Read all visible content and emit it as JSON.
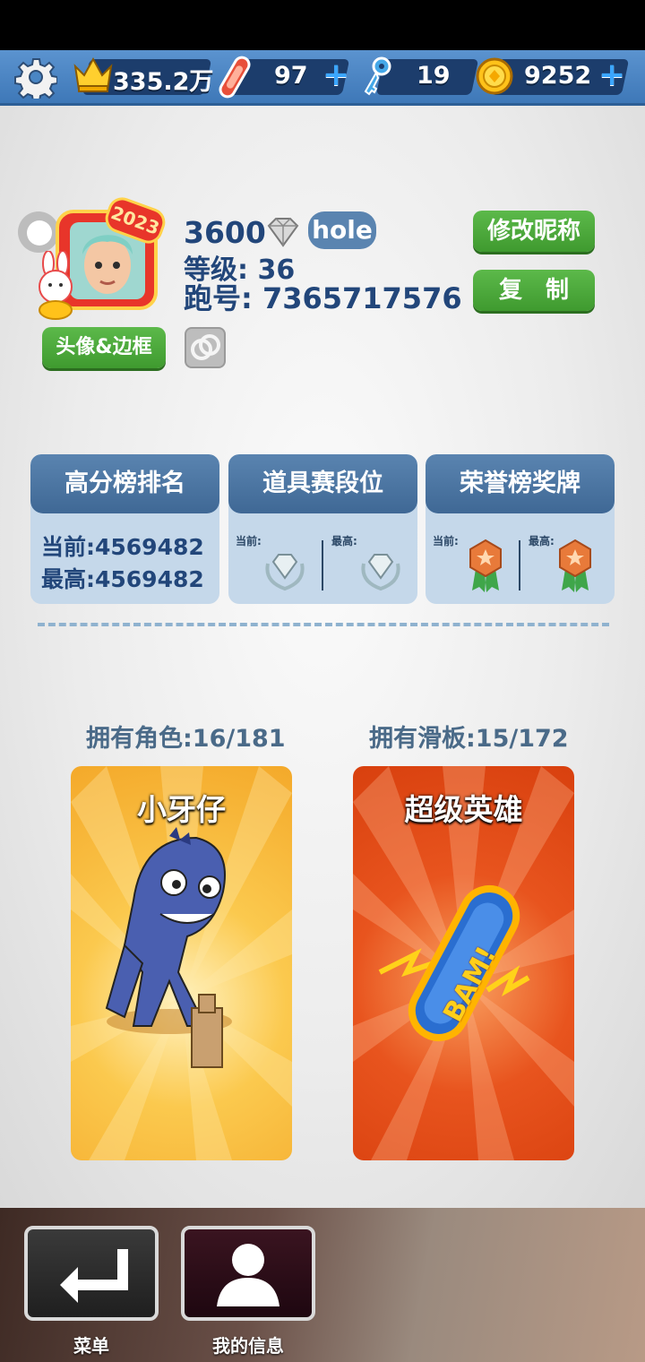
{
  "topbar": {
    "trophies": "335.2万",
    "boards": "97",
    "keys": "19",
    "coins": "9252",
    "plus": "+"
  },
  "profile": {
    "year_badge": "2023",
    "score": "3600",
    "crew": "hole",
    "level": "等级: 36",
    "runner_id": "跑号: 7365717576",
    "rename_label": "修改昵称",
    "copy_label": "复　制",
    "avatar_frame_label": "头像&边框"
  },
  "stats": {
    "highscore": {
      "title": "高分榜排名",
      "current": "当前:4569482",
      "best": "最高:4569482"
    },
    "tournament": {
      "title": "道具赛段位",
      "current_label": "当前:",
      "best_label": "最高:"
    },
    "honor": {
      "title": "荣誉榜奖牌",
      "current_label": "当前:",
      "best_label": "最高:"
    }
  },
  "collection": {
    "characters_owned": "拥有角色:16/181",
    "boards_owned": "拥有滑板:15/172",
    "character_name": "小牙仔",
    "board_name": "超级英雄",
    "board_graphic_text": "BAM!"
  },
  "nav": {
    "menu_label": "菜单",
    "myinfo_label": "我的信息"
  },
  "colors": {
    "accent_green": "#4aa63a",
    "topbar_blue": "#4a86c4",
    "card_blue": "#c5d8ea",
    "character_card": "#f7b23a",
    "board_card": "#e4481a"
  }
}
